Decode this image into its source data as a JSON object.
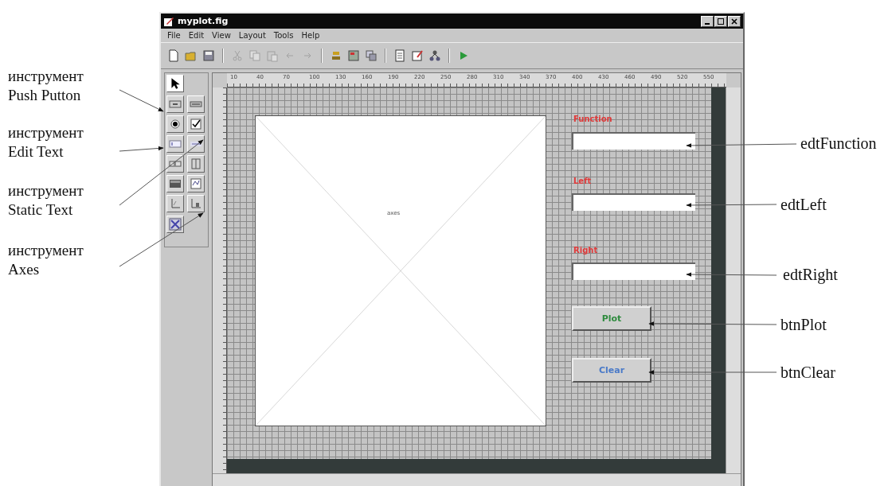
{
  "window": {
    "title": "myplot.fig"
  },
  "menu": [
    "File",
    "Edit",
    "View",
    "Layout",
    "Tools",
    "Help"
  ],
  "ruler": [
    "10",
    "40",
    "70",
    "100",
    "130",
    "160",
    "190",
    "220",
    "250",
    "280",
    "310",
    "340",
    "370",
    "400",
    "430",
    "460",
    "490",
    "520",
    "550"
  ],
  "figure": {
    "axes_label": "axes",
    "controls": [
      {
        "kind": "label",
        "text": "Function"
      },
      {
        "kind": "edit"
      },
      {
        "kind": "label",
        "text": "Left"
      },
      {
        "kind": "edit"
      },
      {
        "kind": "label",
        "text": "Right"
      },
      {
        "kind": "edit"
      },
      {
        "kind": "button",
        "text": "Plot",
        "color": "#2e8b3e"
      },
      {
        "kind": "button",
        "text": "Clear",
        "color": "#4a7ac8"
      }
    ]
  },
  "left_notes": [
    {
      "tool": "инструмент",
      "name": "Push Putton"
    },
    {
      "tool": "инструмент",
      "name": "Edit Text"
    },
    {
      "tool": "инструмент",
      "name": "Static Text"
    },
    {
      "tool": "инструмент",
      "name": "Axes"
    }
  ],
  "right_notes": [
    "edtFunction",
    "edtLeft",
    "edtRight",
    "btnPlot",
    "btnClear"
  ]
}
